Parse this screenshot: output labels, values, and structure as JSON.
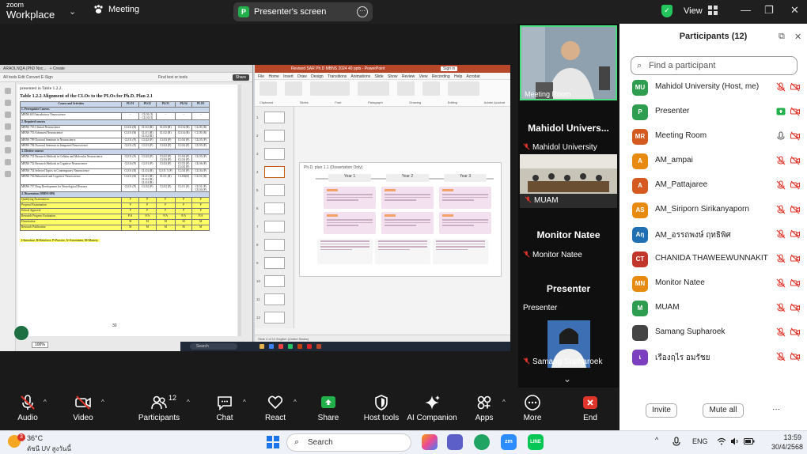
{
  "topbar": {
    "logo_small": "zoom",
    "logo_big": "Workplace",
    "meeting_label": "Meeting",
    "share_label": "Presenter's screen",
    "share_icon_letter": "P",
    "view_label": "View"
  },
  "pdf": {
    "tab_label": "ARAOLNQA (PhD Nsc...",
    "tab2": "+ Create",
    "toolbar_left": "All tools   Edit   Convert   E-Sign",
    "toolbar_right": "Find text or tools",
    "share_badge": "Share",
    "pre_text": "presented in Table 1.2.2.",
    "table_title": "Table 1.2.2 Alignment of the CLOs to the PLOs for Ph.D. Plan 2.1",
    "headers": [
      "Course and Activities",
      "PLO1",
      "PLO2",
      "PLO3",
      "PLO4",
      "PLO5"
    ],
    "sections": [
      {
        "title": "1. Prerequisite Courses",
        "rows": [
          {
            "course": "MBNS 610 Introductory Neuroscience",
            "cells": [
              "-",
              "CLO1 (I)\nCLO2 (I)",
              "-",
              "-",
              "-"
            ]
          }
        ]
      },
      {
        "title": "2. Required courses",
        "rows": [
          {
            "course": "MBNS 755 Clinical Neuroscience",
            "cells": [
              "CLO1 (R)",
              "CLO2 (R)",
              "CLO3 (R)",
              "CLO4 (R)",
              "CLO5 (R)"
            ]
          },
          {
            "course": "MBNS 753 Advanced Neuroscience",
            "cells": [
              "CLO1 (R)",
              "CLO1 (R)\nCLO2 (R)",
              "CLO2 (R)",
              "CLO4 (R)",
              "CLO5 (R)"
            ]
          },
          {
            "course": "MBNS 799 Doctoral Seminars in Neuroscience",
            "cells": [
              "CLO1 (P)",
              "CLO2 (P)",
              "CLO3 (P)",
              "CLO4 (P)",
              "CLO5 (P)"
            ]
          },
          {
            "course": "MBNS 794 Doctoral Seminars in Integrated Neuroscience",
            "cells": [
              "CLO1 (P)",
              "CLO1 (P)",
              "CLO2 (P)",
              "CLO4 (P)",
              "CLO5 (P)"
            ]
          }
        ]
      },
      {
        "title": "3. Elective courses",
        "rows": [
          {
            "course": "MBNS 751 Research Methods in Cellular and Molecular Neuroscience",
            "cells": [
              "CLO1 (P)",
              "CLO2 (P)",
              "CLO2 (P)\nCLO3 (P)",
              "CLO4 (P)\nCLO4 (P)",
              "CLO5 (P)"
            ]
          },
          {
            "course": "MBNS 752 Research Methods in Cognitive Neuroscience",
            "cells": [
              "CLO4 (P)",
              "CLO1 (P)",
              "CLO2 (P)",
              "CLO3 (P)\nCLO4 (P)",
              "CLO6 (P)"
            ]
          },
          {
            "course": "MBNS 754 Selected Topics in Contemporary Neuroscience",
            "cells": [
              "CLO1 (R)",
              "CLO4 (R)",
              "CLO1 5 (P)",
              "CLO4 (P)",
              "CLO4 (P)"
            ]
          },
          {
            "course": "MBNS 756 Behavioral and Cognitive Neuroscience",
            "cells": [
              "CLO1 (R)",
              "CLO1 (R)\nCLO2 (R)\nCLO4 (R)",
              "CLO1 (R)",
              "CLO6(R)",
              "CLO1 (R)"
            ]
          },
          {
            "course": "MBNS 757 Drug Development for Neurological Diseases",
            "cells": [
              "CLO1 (P)",
              "CLO2 (P)",
              "CLO2 (P)",
              "CLO1 (P)",
              "CLO1 (P)\nCLO4 (P)"
            ]
          }
        ]
      }
    ],
    "dissertation_title": "4. Dissertation (MBNS 699)",
    "dissertation_rows": [
      {
        "course": "Qualifying Examination",
        "cells": [
          "P",
          "P",
          "P",
          "P",
          "P"
        ]
      },
      {
        "course": "Proposal Examination",
        "cells": [
          "P",
          "P",
          "P",
          "P",
          "P"
        ]
      },
      {
        "course": "Ethical Approval",
        "cells": [
          "P",
          "P",
          "P",
          "P",
          "P"
        ]
      },
      {
        "course": "Research Progress Evaluation",
        "cells": [
          "P/A",
          "P/A",
          "P/A",
          "P/A",
          "P/A"
        ]
      },
      {
        "course": "Dissertation",
        "cells": [
          "M",
          "M",
          "M",
          "M",
          "M"
        ]
      },
      {
        "course": "Research Publication",
        "cells": [
          "M",
          "M",
          "M",
          "M",
          "M"
        ]
      }
    ],
    "legend": "I=Introduce, R=Reinforce, P=Practice, A=Assessment, M=Mastery",
    "page_number": "30",
    "zoom": "100%"
  },
  "ppt": {
    "title": "Revised SAR Ph.D MBNS 2024 40 ppts - PowerPoint",
    "signin": "Sign in",
    "menus": "File  Home  Insert  Draw  Design  Transitions  Animations  Slide Show  Review  View  Recording  Help  Acrobat",
    "ribbon_labels": [
      "Clipboard",
      "Slides",
      "Font",
      "Paragraph",
      "Drawing",
      "Editing",
      "Adobe Acrobat"
    ],
    "thumb_numbers": [
      "1",
      "2",
      "3",
      "4",
      "5",
      "6",
      "7",
      "8",
      "9",
      "10",
      "11",
      "12"
    ],
    "slide_title": "Ph.D. plan 1.1 (Dissertation Only)",
    "year_labels": [
      "Year 1",
      "Year 2",
      "Year 3"
    ],
    "status": "Slide 4 of 12   English (United States)"
  },
  "taskbar_inner": {
    "search": "Search"
  },
  "videos": {
    "tiles": [
      {
        "label": "Meeting Room"
      },
      {
        "big": "Mahidol Univers...",
        "label": "Mahidol University"
      },
      {
        "label": "MUAM"
      },
      {
        "big": "Monitor Natee",
        "label": "Monitor Natee"
      },
      {
        "big": "Presenter",
        "label": "Presenter"
      },
      {
        "label": "Samang Supharoek"
      }
    ]
  },
  "participants": {
    "title": "Participants (12)",
    "search_placeholder": "Find a participant",
    "list": [
      {
        "initials": "MU",
        "name": "Mahidol University (Host, me)",
        "color": "#2e9d4f",
        "mic": "muted",
        "cam": "off"
      },
      {
        "initials": "P",
        "name": "Presenter",
        "color": "#2e9d4f",
        "mic": "share",
        "cam": "off"
      },
      {
        "initials": "MR",
        "name": "Meeting Room",
        "color": "#d45a1f",
        "mic": "on",
        "cam": "off"
      },
      {
        "initials": "A",
        "name": "AM_ampai",
        "color": "#e88a10",
        "mic": "muted",
        "cam": "off"
      },
      {
        "initials": "A",
        "name": "AM_Pattajaree",
        "color": "#d45a1f",
        "mic": "muted",
        "cam": "off"
      },
      {
        "initials": "AS",
        "name": "AM_Siriporn Sirikanyaporn",
        "color": "#e88a10",
        "mic": "muted",
        "cam": "off"
      },
      {
        "initials": "Aη",
        "name": "AM_อรรถพงษ์ ฤทธิพิศ",
        "color": "#1f6fb2",
        "mic": "muted",
        "cam": "off"
      },
      {
        "initials": "CT",
        "name": "CHANIDA THAWEEWUNNAKIT",
        "color": "#c2352b",
        "mic": "muted",
        "cam": "off"
      },
      {
        "initials": "MN",
        "name": "Monitor Natee",
        "color": "#e88a10",
        "mic": "muted",
        "cam": "off"
      },
      {
        "initials": "M",
        "name": "MUAM",
        "color": "#2e9d4f",
        "mic": "muted",
        "cam": "off"
      },
      {
        "initials": "",
        "name": "Samang Supharoek",
        "color": "#444444",
        "mic": "muted",
        "cam": "off"
      },
      {
        "initials": "เ",
        "name": "เรืองฤไร อมรัชย",
        "color": "#7b3fbf",
        "mic": "muted",
        "cam": "off"
      }
    ],
    "invite": "Invite",
    "mute_all": "Mute all",
    "more": "···"
  },
  "toolbar": {
    "audio": "Audio",
    "video": "Video",
    "participants": "Participants",
    "participants_count": "12",
    "chat": "Chat",
    "react": "React",
    "share": "Share",
    "host_tools": "Host tools",
    "ai_companion": "AI Companion",
    "apps": "Apps",
    "more": "More",
    "end": "End"
  },
  "windows": {
    "weather_temp": "36°C",
    "weather_desc": "ดัชนี UV สูงวันนี้",
    "weather_badge": "3",
    "search": "Search",
    "lang": "ENG",
    "time": "13:59",
    "date": "30/4/2568"
  },
  "colors": {
    "accent_green": "#22b04b",
    "mute_red": "#e0352b",
    "end_red": "#e0352b"
  }
}
